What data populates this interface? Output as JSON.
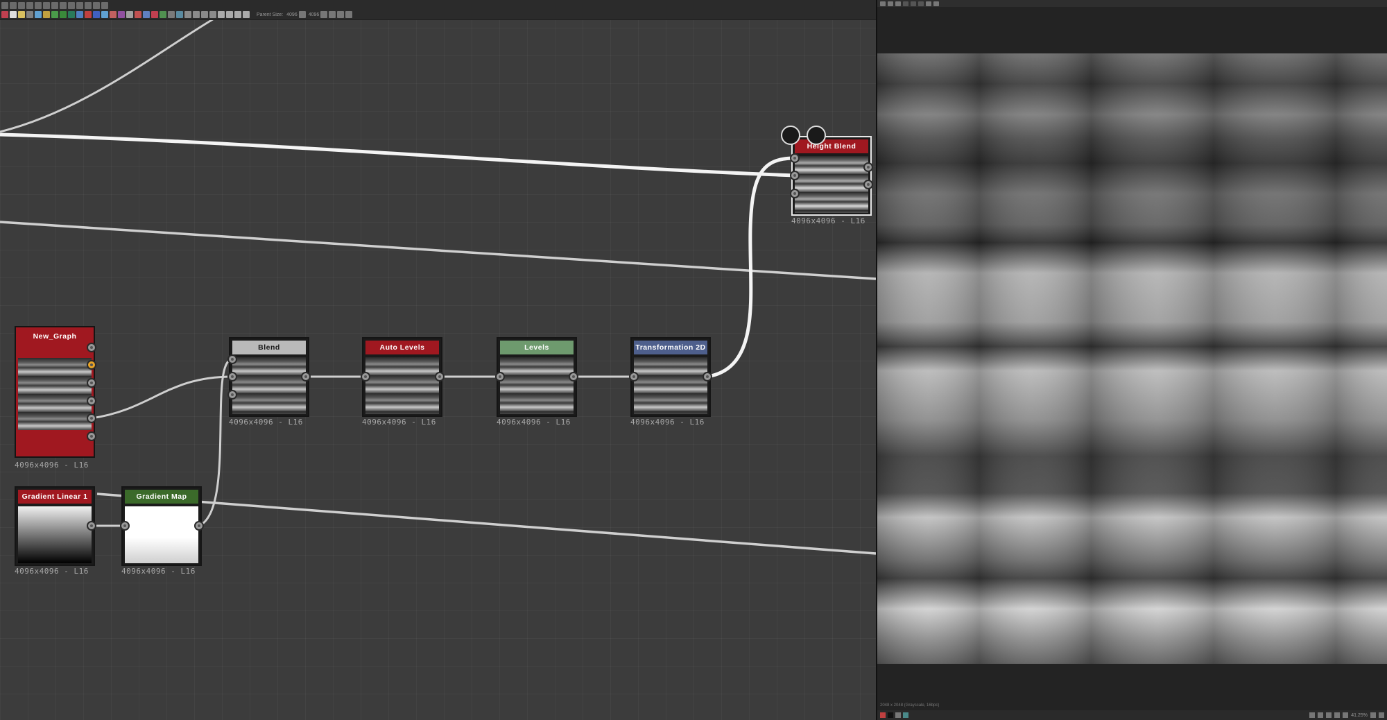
{
  "toolbar": {
    "parent_size_label": "Parent Size:",
    "parent_size_w": "4096",
    "parent_size_h": "4096"
  },
  "nodes": {
    "new_graph": {
      "title": "New_Graph",
      "resolution": "4096x4096 - L16",
      "title_color": "#a01820"
    },
    "blend": {
      "title": "Blend",
      "resolution": "4096x4096 - L16",
      "title_color": "#b9b9b9"
    },
    "auto_levels": {
      "title": "Auto Levels",
      "resolution": "4096x4096 - L16",
      "title_color": "#a01820"
    },
    "levels": {
      "title": "Levels",
      "resolution": "4096x4096 - L16",
      "title_color": "#6e9a6e"
    },
    "transformation_2d": {
      "title": "Transformation 2D",
      "resolution": "4096x4096 - L16",
      "title_color": "#4e5f8c"
    },
    "height_blend": {
      "title": "Height Blend",
      "resolution": "4096x4096 - L16",
      "title_color": "#a01820"
    },
    "gradient_linear_1": {
      "title": "Gradient Linear 1",
      "resolution": "4096x4096 - L16",
      "title_color": "#a01820"
    },
    "gradient_map": {
      "title": "Gradient Map",
      "resolution": "4096x4096 - L16",
      "title_color": "#3b6a2a"
    }
  },
  "viewer": {
    "info": "2048 x 2048 (Grayscale, 16bpc)",
    "zoom": "41.25%"
  }
}
